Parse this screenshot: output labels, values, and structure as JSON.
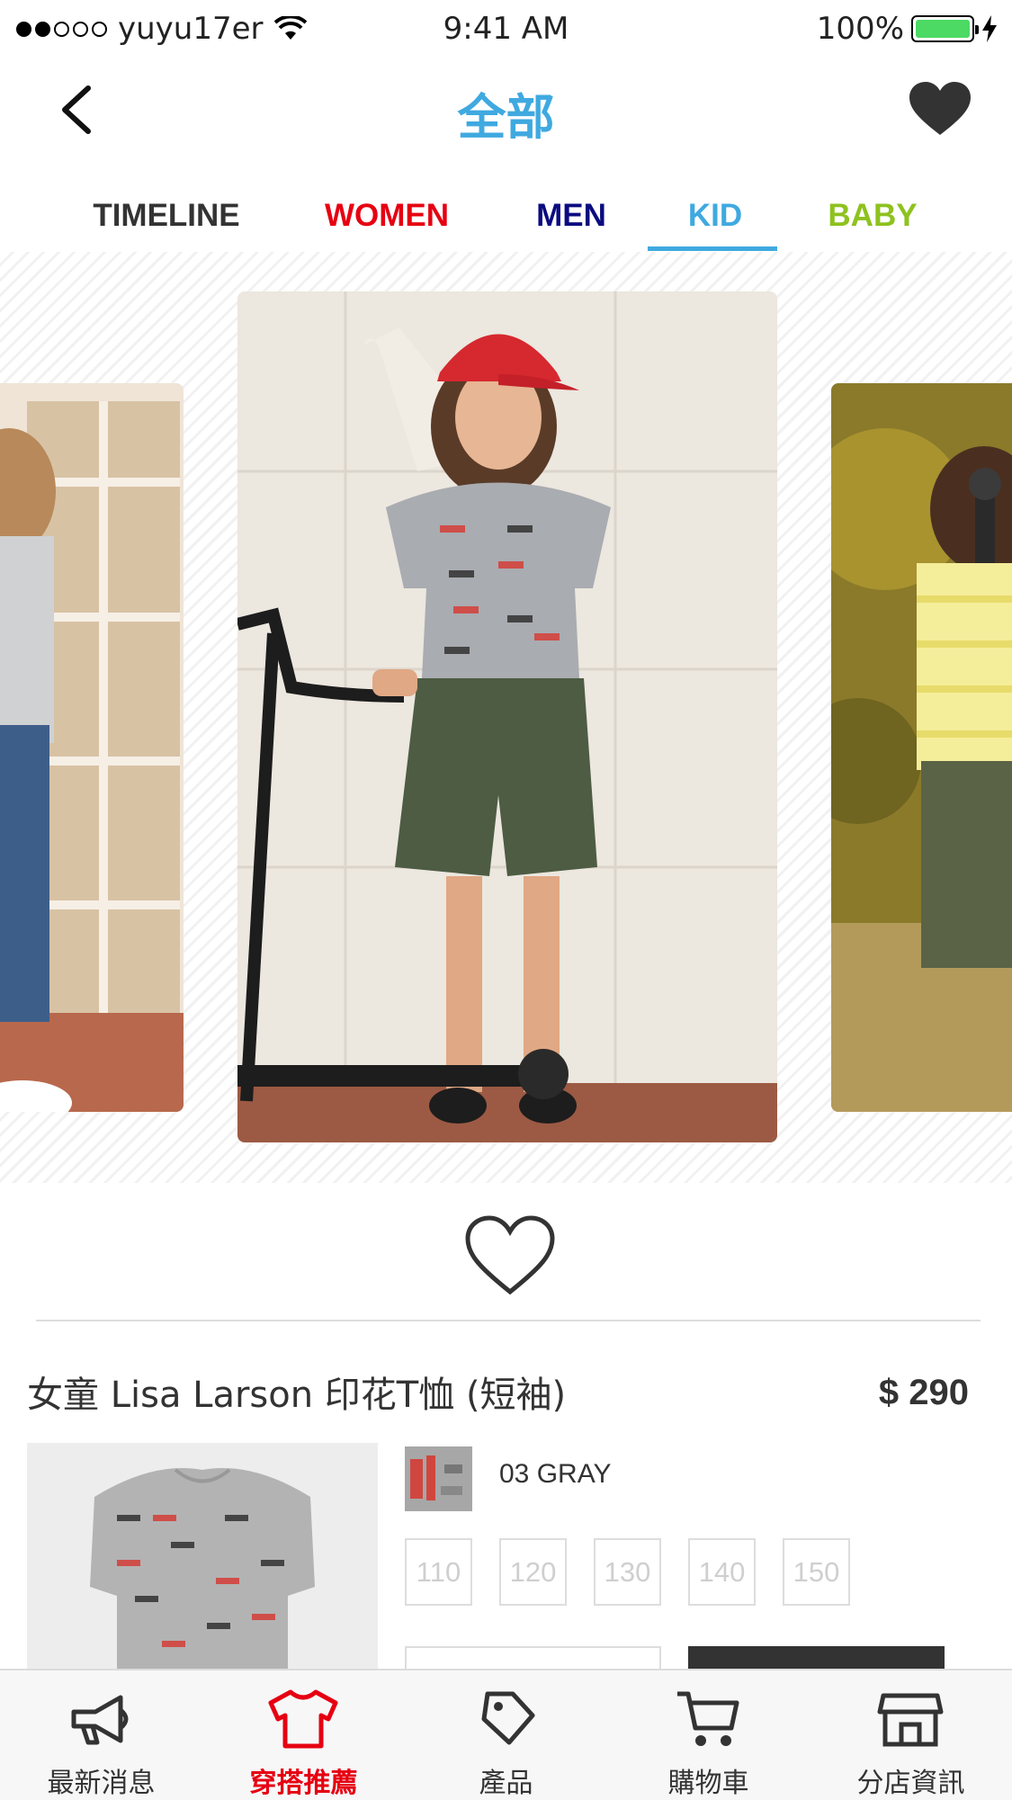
{
  "status_bar": {
    "carrier": "yuyu17er",
    "time": "9:41 AM",
    "battery": "100%"
  },
  "nav": {
    "title": "全部"
  },
  "tabs": [
    {
      "label": "TIMELINE",
      "color": "#333333"
    },
    {
      "label": "WOMEN",
      "color": "#e60012"
    },
    {
      "label": "MEN",
      "color": "#0b0b80"
    },
    {
      "label": "KID",
      "color": "#3fa9e0",
      "active": true
    },
    {
      "label": "BABY",
      "color": "#8ec21f"
    }
  ],
  "product": {
    "name": "女童 Lisa Larson 印花T恤 (短袖)",
    "price": "$ 290",
    "color_name": "03 GRAY",
    "sizes": [
      "110",
      "120",
      "130",
      "140",
      "150"
    ]
  },
  "tabbar": [
    {
      "label": "最新消息",
      "icon": "megaphone-icon"
    },
    {
      "label": "穿搭推薦",
      "icon": "tshirt-icon",
      "active": true
    },
    {
      "label": "產品",
      "icon": "tag-icon"
    },
    {
      "label": "購物車",
      "icon": "cart-icon"
    },
    {
      "label": "分店資訊",
      "icon": "store-icon"
    }
  ],
  "colors": {
    "accent": "#3fa9e0",
    "active_tab": "#e60012"
  }
}
